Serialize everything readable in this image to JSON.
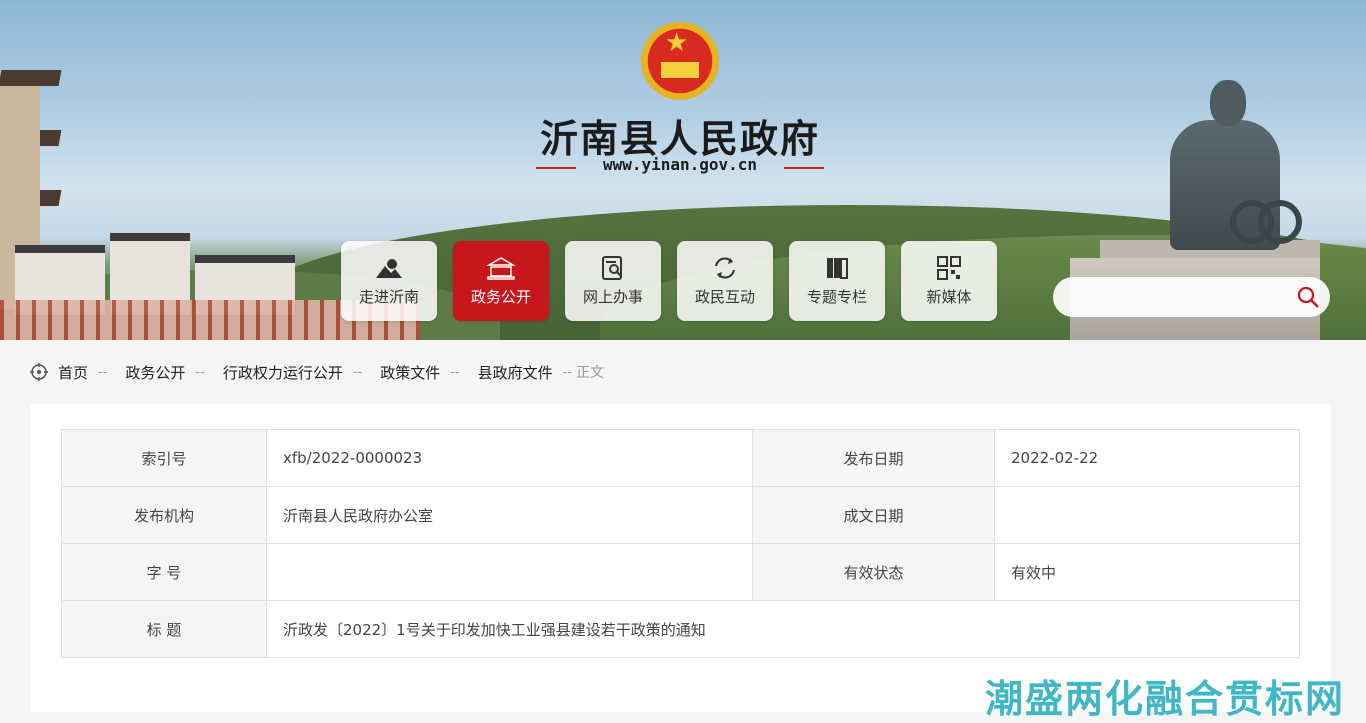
{
  "header": {
    "site_title": "沂南县人民政府",
    "site_url": "www.yinan.gov.cn"
  },
  "nav": {
    "items": [
      {
        "label": "走进沂南",
        "icon": "landscape-icon",
        "active": false
      },
      {
        "label": "政务公开",
        "icon": "building-icon",
        "active": true
      },
      {
        "label": "网上办事",
        "icon": "document-search-icon",
        "active": false
      },
      {
        "label": "政民互动",
        "icon": "exchange-icon",
        "active": false
      },
      {
        "label": "专题专栏",
        "icon": "books-icon",
        "active": false
      },
      {
        "label": "新媒体",
        "icon": "qrcode-icon",
        "active": false
      }
    ]
  },
  "search": {
    "placeholder": ""
  },
  "breadcrumb": {
    "items": [
      "首页",
      "政务公开",
      "行政权力运行公开",
      "政策文件",
      "县政府文件"
    ],
    "separator": "--",
    "current": "正文"
  },
  "info": {
    "index_label": "索引号",
    "index_value": "xfb/2022-0000023",
    "publish_date_label": "发布日期",
    "publish_date_value": "2022-02-22",
    "publisher_label": "发布机构",
    "publisher_value": "沂南县人民政府办公室",
    "written_date_label": "成文日期",
    "written_date_value": "",
    "doc_no_label": "字 号",
    "doc_no_value": "",
    "status_label": "有效状态",
    "status_value": "有效中",
    "title_label": "标 题",
    "title_value": "沂政发〔2022〕1号关于印发加快工业强县建设若干政策的通知"
  },
  "watermark": "潮盛两化融合贯标网",
  "colors": {
    "accent": "#c8161d",
    "watermark": "#3fb7c6"
  }
}
